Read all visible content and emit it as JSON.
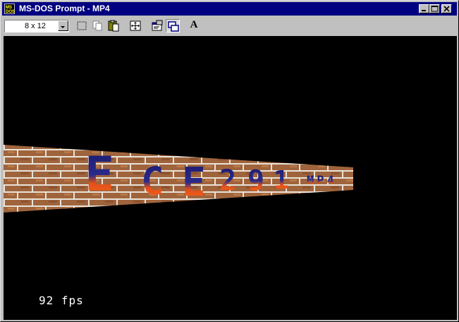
{
  "window": {
    "title": "MS-DOS Prompt - MP4",
    "controls": [
      "minimize",
      "maximize",
      "close"
    ]
  },
  "toolbar": {
    "font_size": "8 x 12",
    "tools": [
      {
        "name": "mark",
        "icon": "mark-icon"
      },
      {
        "name": "copy",
        "icon": "copy-icon"
      },
      {
        "name": "paste",
        "icon": "paste-icon"
      },
      {
        "name": "full-screen",
        "icon": "full-screen-icon"
      },
      {
        "name": "properties",
        "icon": "properties-icon"
      },
      {
        "name": "background",
        "icon": "background-icon",
        "pressed": true
      },
      {
        "name": "font",
        "icon": "font-icon",
        "glyph": "A"
      }
    ]
  },
  "screen": {
    "wall_text": [
      "E",
      "C",
      "E",
      "2",
      "9",
      "1",
      "MP4"
    ],
    "fps_text": "92 fps",
    "colors": {
      "background": "#000000",
      "brick": "#a0643c",
      "mortar": "#e8e2d8",
      "glyph_top": "#1a1a6e",
      "glyph_bottom": "#e0501a"
    }
  }
}
